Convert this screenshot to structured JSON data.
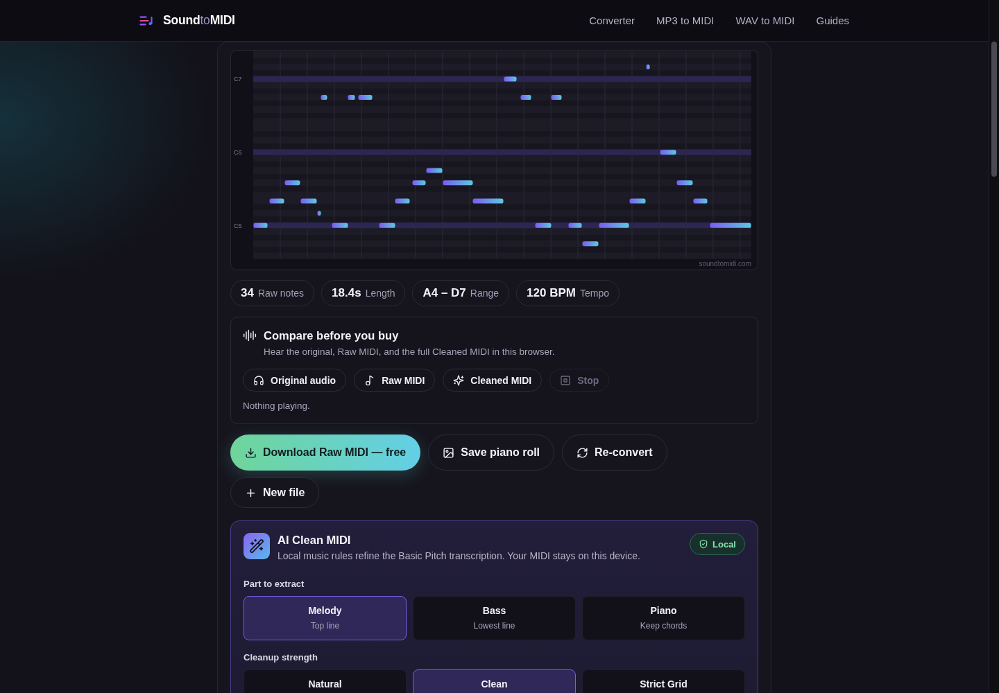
{
  "header": {
    "logo": "**Sound**to**MIDI**",
    "nav": [
      "Converter",
      "MP3 to MIDI",
      "WAV to MIDI",
      "Guides"
    ]
  },
  "piano_roll": {
    "pitch_labels": [
      "C7",
      "C6",
      "C5"
    ],
    "watermark": "soundtomidi.com"
  },
  "stats": [
    {
      "value": "34",
      "label": "Raw notes"
    },
    {
      "value": "18.4s",
      "label": "Length"
    },
    {
      "value": "A4 – D7",
      "label": "Range"
    },
    {
      "value": "120 BPM",
      "label": "Tempo"
    }
  ],
  "compare": {
    "title": "Compare before you buy",
    "subtitle": "Hear the original, Raw MIDI, and the full Cleaned MIDI in this browser.",
    "buttons": [
      {
        "label": "Original audio",
        "disabled": false
      },
      {
        "label": "Raw MIDI",
        "disabled": false
      },
      {
        "label": "Cleaned MIDI",
        "disabled": false
      },
      {
        "label": "Stop",
        "disabled": true
      }
    ],
    "status": "Nothing playing."
  },
  "actions": [
    {
      "label": "Download Raw MIDI — free",
      "kind": "primary"
    },
    {
      "label": "Save piano roll",
      "kind": "secondary"
    },
    {
      "label": "Re-convert",
      "kind": "secondary"
    },
    {
      "label": "New file",
      "kind": "secondary"
    }
  ],
  "ai_clean": {
    "title": "AI Clean MIDI",
    "subtitle": "Local music rules refine the Basic Pitch transcription. Your MIDI stays on this device.",
    "badge": "Local",
    "groups": [
      {
        "label": "Part to extract",
        "options": [
          {
            "title": "Melody",
            "subtitle": "Top line",
            "selected": true
          },
          {
            "title": "Bass",
            "subtitle": "Lowest line",
            "selected": false
          },
          {
            "title": "Piano",
            "subtitle": "Keep chords",
            "selected": false
          }
        ]
      },
      {
        "label": "Cleanup strength",
        "options": [
          {
            "title": "Natural",
            "selected": false
          },
          {
            "title": "Clean",
            "selected": true
          },
          {
            "title": "Strict Grid",
            "selected": false
          }
        ]
      }
    ]
  }
}
